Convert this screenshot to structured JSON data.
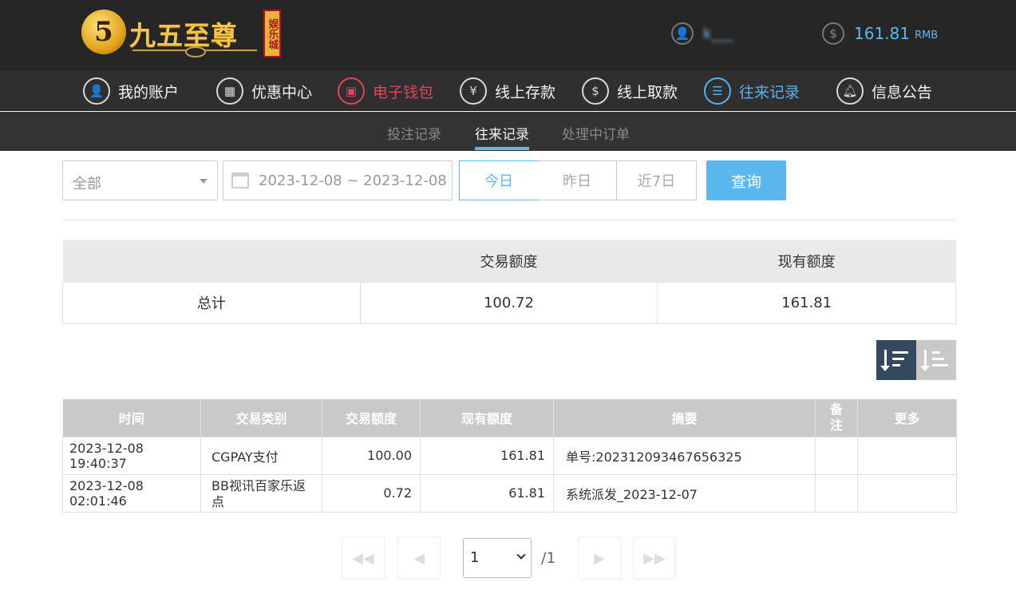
{
  "brand": {
    "badge": "5",
    "name": "九五至尊",
    "tag": "娱乐城"
  },
  "account": {
    "username": "k___",
    "balance": "161.81",
    "currency": "RMB"
  },
  "nav": [
    {
      "label": "我的账户",
      "icon": "user-icon"
    },
    {
      "label": "优惠中心",
      "icon": "gift-icon"
    },
    {
      "label": "电子钱包",
      "icon": "wallet-icon"
    },
    {
      "label": "线上存款",
      "icon": "deposit-icon"
    },
    {
      "label": "线上取款",
      "icon": "withdraw-icon"
    },
    {
      "label": "往来记录",
      "icon": "records-icon"
    },
    {
      "label": "信息公告",
      "icon": "bell-icon"
    }
  ],
  "subnav": [
    "投注记录",
    "往来记录",
    "处理中订单"
  ],
  "filters": {
    "type": "全部",
    "date_range": "2023-12-08 ~ 2023-12-08",
    "quick": [
      "今日",
      "昨日",
      "近7日"
    ],
    "search": "查询"
  },
  "summary": {
    "headers": [
      "",
      "交易额度",
      "现有额度"
    ],
    "row_label": "总计",
    "transaction": "100.72",
    "current": "161.81"
  },
  "table": {
    "headers": [
      "时间",
      "交易类别",
      "交易额度",
      "现有额度",
      "摘要",
      "备注",
      "更多"
    ],
    "rows": [
      {
        "time": "2023-12-08 19:40:37",
        "type": "CGPAY支付",
        "amount": "100.00",
        "balance": "161.81",
        "summary": "单号:202312093467656325",
        "note": "",
        "more": ""
      },
      {
        "time": "2023-12-08 02:01:46",
        "type": "BB视讯百家乐返点",
        "amount": "0.72",
        "balance": "61.81",
        "summary": "系统派发_2023-12-07",
        "note": "",
        "more": ""
      }
    ]
  },
  "pagination": {
    "page": "1",
    "total": "/1"
  },
  "colors": {
    "accent": "#5bb8ef",
    "active_red": "#e2425a",
    "header_dark": "#262626"
  }
}
